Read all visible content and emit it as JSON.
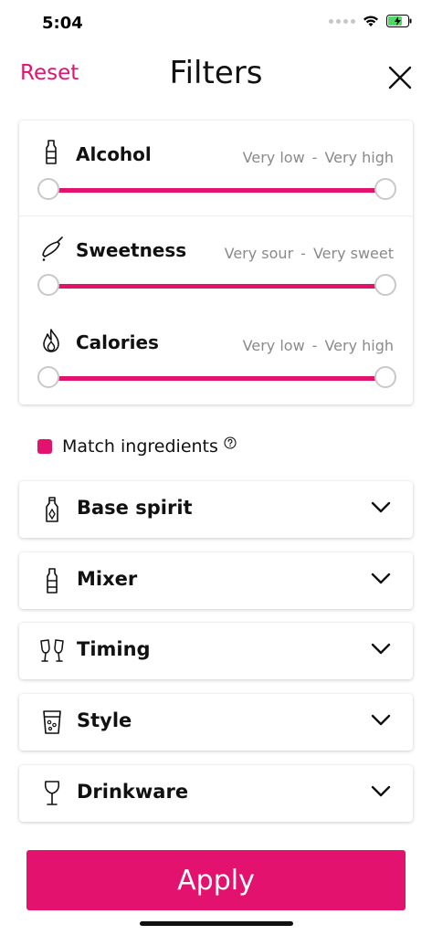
{
  "status_bar": {
    "time": "5:04",
    "icons": [
      "signal-dots-icon",
      "wifi-icon",
      "battery-charging-icon"
    ]
  },
  "header": {
    "reset_label": "Reset",
    "title": "Filters",
    "close_icon": "close-icon"
  },
  "sliders": [
    {
      "label": "Alcohol",
      "icon": "bottle-icon",
      "min_label": "Very low",
      "max_label": "Very high",
      "range_min": 0,
      "range_max": 1
    },
    {
      "label": "Sweetness",
      "icon": "sweetness-icon",
      "min_label": "Very sour",
      "max_label": "Very sweet",
      "range_min": 0,
      "range_max": 1
    },
    {
      "label": "Calories",
      "icon": "flame-icon",
      "min_label": "Very low",
      "max_label": "Very high",
      "range_min": 0,
      "range_max": 1
    }
  ],
  "range_separator": "-",
  "match_ingredients": {
    "label": "Match ingredients",
    "checked": true,
    "help_icon": "help-icon"
  },
  "sections": [
    {
      "label": "Base spirit",
      "icon": "spirit-bottle-icon",
      "expanded": false
    },
    {
      "label": "Mixer",
      "icon": "mixer-bottle-icon",
      "expanded": false
    },
    {
      "label": "Timing",
      "icon": "cheers-glasses-icon",
      "expanded": false
    },
    {
      "label": "Style",
      "icon": "fizzy-glass-icon",
      "expanded": false
    },
    {
      "label": "Drinkware",
      "icon": "wine-glass-icon",
      "expanded": false
    }
  ],
  "apply_label": "Apply",
  "colors": {
    "accent": "#e2126e",
    "text": "#111111",
    "muted": "#8a8a8a",
    "knob_border": "#c8c8c8"
  }
}
